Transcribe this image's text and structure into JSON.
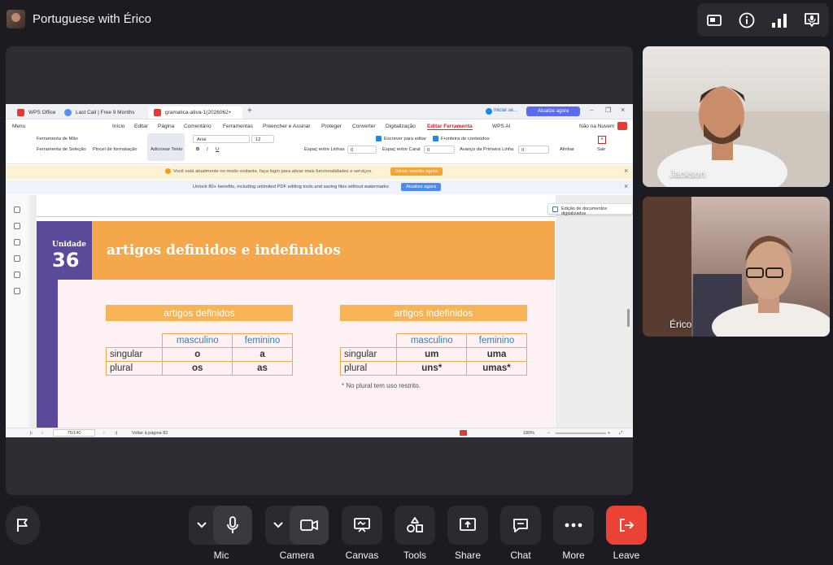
{
  "meeting": {
    "title": "Portuguese with Érico"
  },
  "top_icons": [
    "pip-icon",
    "info-icon",
    "signal-icon",
    "mic-status-icon"
  ],
  "wps": {
    "tabs": [
      {
        "label": "WPS Office"
      },
      {
        "label": "Last Call | Free 9 Months"
      },
      {
        "label": "gramatica-ativa-1(2026062+"
      }
    ],
    "signin": "Iniciar se...",
    "upgrade": "Atualize agora",
    "menu": [
      "Menu",
      "Início",
      "Editar",
      "Página",
      "Comentário",
      "Ferramentas",
      "Preencher e Assinar",
      "Proteger",
      "Converter",
      "Digitalização",
      "Editar Ferramenta",
      "WPS AI"
    ],
    "active_menu": "Editar Ferramenta",
    "cloud": "Não na Nuvem",
    "ribbon": {
      "hand_tool": "Ferramenta de Mão",
      "select_tool": "Ferramenta de Seleção",
      "format_brush": "Pincel de formatação",
      "add_text": "Adicionar Texto",
      "font": "Arial",
      "size": "12",
      "write_edit": "Escrever para editar",
      "content_border": "Fronteira de conteúdos",
      "line_spacing": "Espaç entre Linhas",
      "char_spacing": "Espaç entre Carat",
      "first_line": "Avanço da Primeira Linha",
      "zero": "0",
      "align": "Alinhar",
      "exit": "Sair"
    },
    "notice1": {
      "text": "Você está atualmente no modo visitante, faça login para ativar mais funcionalidades e serviços.",
      "button": "Iniciar sessão agora"
    },
    "notice2": {
      "text": "Unlock 80+ benefits, including unlimited PDF editing tools and saving files without watermarks",
      "button": "Atualize agora"
    },
    "float_btn": "Edição de documentos digitalizados",
    "status": {
      "page": "75/140",
      "back": "Voltar à página 82",
      "zoom": "180%"
    }
  },
  "document": {
    "unit_label": "Unidade",
    "unit_number": "36",
    "title": "artigos definidos e indefinidos",
    "definite": {
      "header": "artigos definidos",
      "cols": [
        "masculino",
        "feminino"
      ],
      "rows": [
        [
          "singular",
          "o",
          "a"
        ],
        [
          "plural",
          "os",
          "as"
        ]
      ]
    },
    "indefinite": {
      "header": "artigos indefinidos",
      "cols": [
        "masculino",
        "feminino"
      ],
      "rows": [
        [
          "singular",
          "um",
          "uma"
        ],
        [
          "plural",
          "uns*",
          "umas*"
        ]
      ],
      "footnote": "* No plural tem uso restrito."
    }
  },
  "participants": [
    {
      "name": "Jackson"
    },
    {
      "name": "Érico"
    }
  ],
  "controls": {
    "mic": "Mic",
    "camera": "Camera",
    "canvas": "Canvas",
    "tools": "Tools",
    "share": "Share",
    "chat": "Chat",
    "more": "More",
    "leave": "Leave"
  }
}
